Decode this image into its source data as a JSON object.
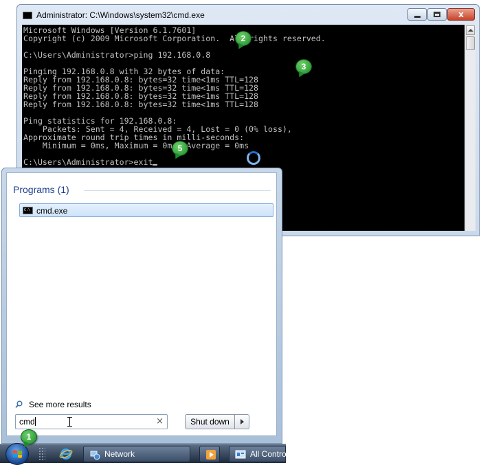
{
  "cmd_window": {
    "title": "Administrator: C:\\Windows\\system32\\cmd.exe",
    "lines": [
      "Microsoft Windows [Version 6.1.7601]",
      "Copyright (c) 2009 Microsoft Corporation.  All rights reserved.",
      "",
      "C:\\Users\\Administrator>ping 192.168.0.8",
      "",
      "Pinging 192.168.0.8 with 32 bytes of data:",
      "Reply from 192.168.0.8: bytes=32 time<1ms TTL=128",
      "Reply from 192.168.0.8: bytes=32 time<1ms TTL=128",
      "Reply from 192.168.0.8: bytes=32 time<1ms TTL=128",
      "Reply from 192.168.0.8: bytes=32 time<1ms TTL=128",
      "",
      "Ping statistics for 192.168.0.8:",
      "    Packets: Sent = 4, Received = 4, Lost = 0 (0% loss),",
      "Approximate round trip times in milli-seconds:",
      "    Minimum = 0ms, Maximum = 0ms, Average = 0ms",
      "",
      "C:\\Users\\Administrator>exit"
    ],
    "close_glyph": "x"
  },
  "callouts": [
    "1",
    "2",
    "3",
    "5"
  ],
  "start_menu": {
    "programs_header": "Programs (1)",
    "result_item": "cmd.exe",
    "see_more": "See more results",
    "search_value": "cmd",
    "clear_glyph": "×",
    "shutdown_label": "Shut down"
  },
  "taskbar": {
    "network_label": "Network",
    "control_panel_label": "All Contro"
  },
  "colors": {
    "console_bg": "#000000",
    "console_text": "#c0c0c0",
    "callout_green": "#1c8a2a",
    "programs_header": "#1e3f8a",
    "taskbar": "#1d2a3d"
  }
}
